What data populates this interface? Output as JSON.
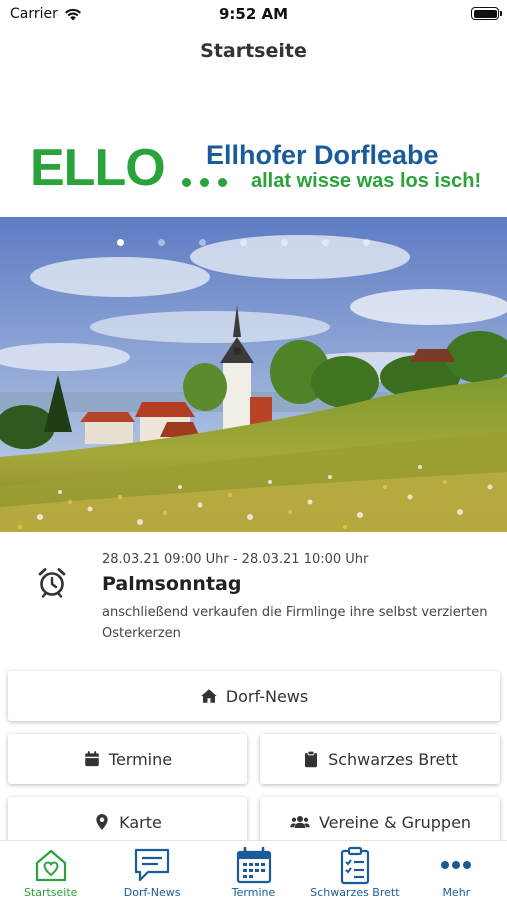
{
  "status_bar": {
    "carrier": "Carrier",
    "time": "9:52 AM"
  },
  "nav": {
    "title": "Startseite"
  },
  "logo": {
    "word": "ELLO",
    "title": "Ellhofer Dorfleabe",
    "slogan": "allat wisse was los isch!",
    "colors": {
      "green": "#2aa33a",
      "blue": "#1a5c9a"
    }
  },
  "hero": {
    "pages": 7,
    "active_page": 1
  },
  "event": {
    "icon": "alarm-clock-icon",
    "date_range": "28.03.21 09:00 Uhr - 28.03.21 10:00 Uhr",
    "title": "Palmsonntag",
    "description": "anschließend verkaufen die Firmlinge ihre selbst verzierten Osterkerzen"
  },
  "tiles": {
    "dorf_news": {
      "label": "Dorf-News",
      "icon": "home-icon"
    },
    "termine": {
      "label": "Termine",
      "icon": "calendar-icon"
    },
    "schwarzes_brett": {
      "label": "Schwarzes Brett",
      "icon": "clipboard-icon"
    },
    "karte": {
      "label": "Karte",
      "icon": "map-pin-icon"
    },
    "vereine": {
      "label": "Vereine & Gruppen",
      "icon": "users-icon"
    }
  },
  "tabbar": {
    "active_color": "#2aa33a",
    "inactive_color": "#1a5c9a",
    "items": [
      {
        "label": "Startseite",
        "icon": "home-heart-icon",
        "active": true
      },
      {
        "label": "Dorf-News",
        "icon": "chat-bubble-icon",
        "active": false
      },
      {
        "label": "Termine",
        "icon": "calendar-icon",
        "active": false
      },
      {
        "label": "Schwarzes Brett",
        "icon": "clipboard-list-icon",
        "active": false
      },
      {
        "label": "Mehr",
        "icon": "more-dots-icon",
        "active": false
      }
    ]
  }
}
